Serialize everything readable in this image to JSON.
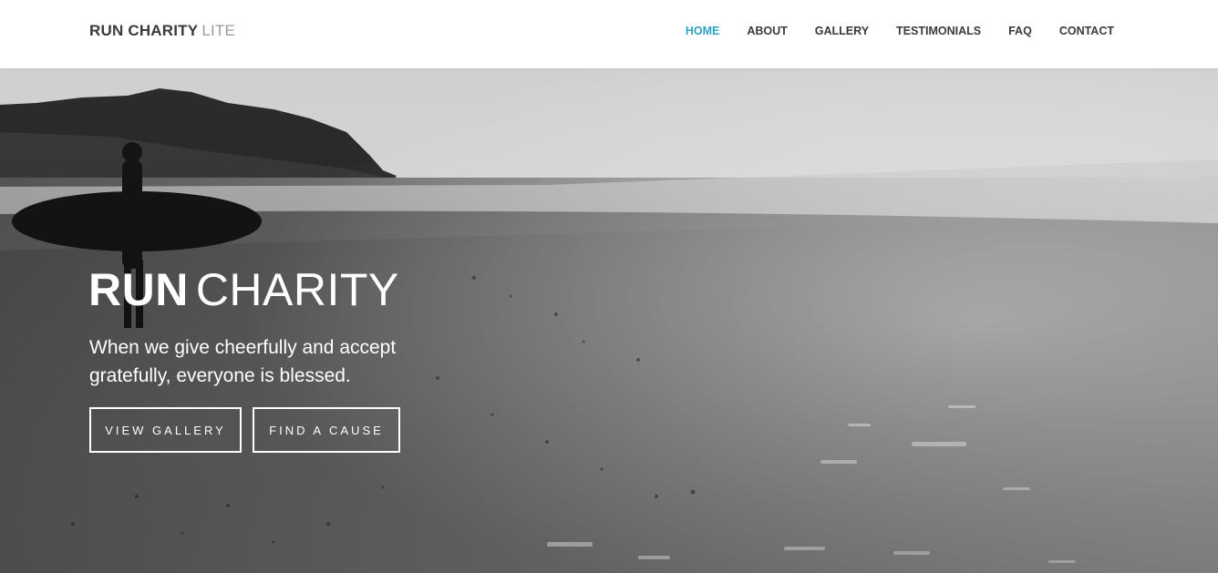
{
  "brand": {
    "bold": "RUN CHARITY",
    "light": "LITE"
  },
  "nav": {
    "items": [
      "HOME",
      "ABOUT",
      "GALLERY",
      "TESTIMONIALS",
      "FAQ",
      "CONTACT"
    ],
    "active": "HOME"
  },
  "hero": {
    "title_bold": "RUN",
    "title_light": "CHARITY",
    "subtitle": "When we give cheerfully and accept gratefully, everyone is blessed.",
    "buttons": {
      "gallery": "VIEW GALLERY",
      "cause": "FIND A CAUSE"
    },
    "background": "black-and-white photo of a surfer holding a board on a beach with cliffs and sea"
  },
  "colors": {
    "accent": "#2aa3c4",
    "text": "#3a3a3a",
    "muted": "#9a9a9a",
    "white": "#ffffff"
  }
}
